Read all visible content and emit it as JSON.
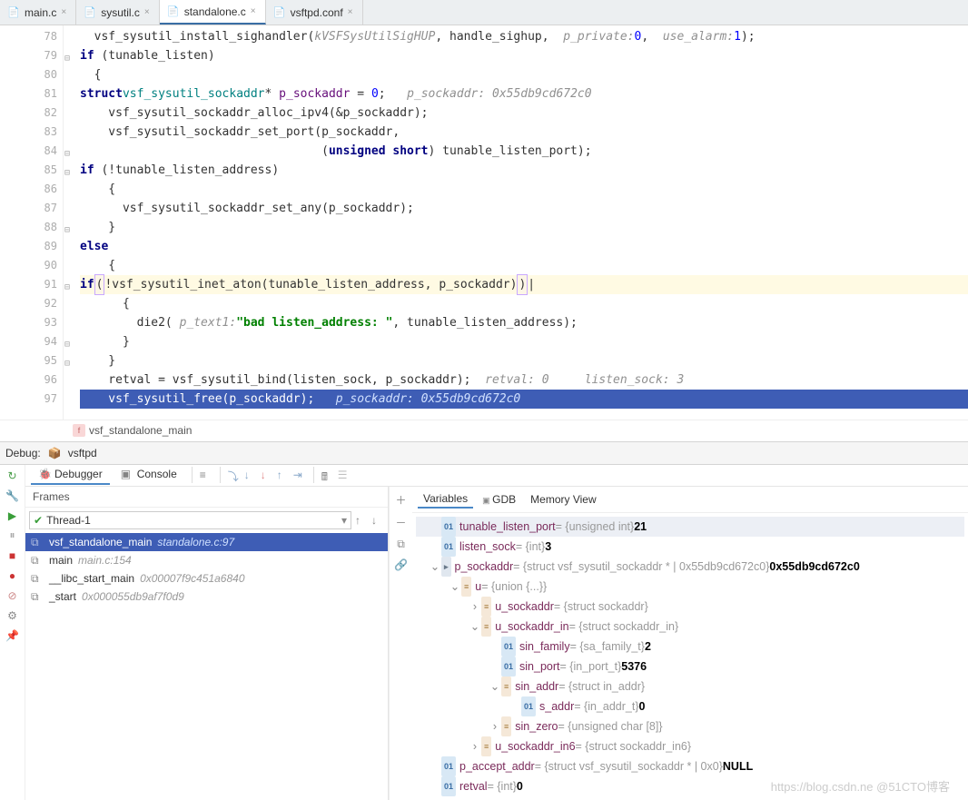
{
  "tabs": [
    {
      "name": "main.c",
      "active": false
    },
    {
      "name": "sysutil.c",
      "active": false
    },
    {
      "name": "standalone.c",
      "active": true
    },
    {
      "name": "vsftpd.conf",
      "active": false
    }
  ],
  "breadcrumb": {
    "fn": "vsf_standalone_main"
  },
  "debug": {
    "label": "Debug:",
    "config": "vsftpd",
    "tabs": {
      "debugger": "Debugger",
      "console": "Console"
    },
    "frames_title": "Frames",
    "thread": "Thread-1",
    "frames": [
      {
        "fn": "vsf_standalone_main",
        "loc": "standalone.c:97",
        "sel": true
      },
      {
        "fn": "main",
        "loc": "main.c:154",
        "sel": false
      },
      {
        "fn": "__libc_start_main",
        "loc": "0x00007f9c451a6840",
        "sel": false
      },
      {
        "fn": "_start",
        "loc": "0x000055db9af7f0d9",
        "sel": false
      }
    ],
    "vars_tabs": {
      "variables": "Variables",
      "gdb": "GDB",
      "memory": "Memory View"
    }
  },
  "variables": [
    {
      "d": 0,
      "ic": "01",
      "name": "tunable_listen_port",
      "type": "{unsigned int}",
      "val": "21",
      "sel": true
    },
    {
      "d": 0,
      "ic": "01",
      "name": "listen_sock",
      "type": "{int}",
      "val": "3"
    },
    {
      "d": 0,
      "ic": "p",
      "name": "p_sockaddr",
      "type": "{struct vsf_sysutil_sockaddr * | 0x55db9cd672c0}",
      "val": "0x55db9cd672c0",
      "exp": "v"
    },
    {
      "d": 1,
      "ic": "f",
      "name": "u",
      "type": "{union {...}}",
      "val": "",
      "exp": "v"
    },
    {
      "d": 2,
      "ic": "f",
      "name": "u_sockaddr",
      "type": "{struct sockaddr}",
      "val": "",
      "exp": ">"
    },
    {
      "d": 2,
      "ic": "f",
      "name": "u_sockaddr_in",
      "type": "{struct sockaddr_in}",
      "val": "",
      "exp": "v"
    },
    {
      "d": 3,
      "ic": "01",
      "name": "sin_family",
      "type": "{sa_family_t}",
      "val": "2"
    },
    {
      "d": 3,
      "ic": "01",
      "name": "sin_port",
      "type": "{in_port_t}",
      "val": "5376"
    },
    {
      "d": 3,
      "ic": "f",
      "name": "sin_addr",
      "type": "{struct in_addr}",
      "val": "",
      "exp": "v"
    },
    {
      "d": 4,
      "ic": "01",
      "name": "s_addr",
      "type": "{in_addr_t}",
      "val": "0"
    },
    {
      "d": 3,
      "ic": "f",
      "name": "sin_zero",
      "type": "{unsigned char [8]}",
      "val": "",
      "exp": ">"
    },
    {
      "d": 2,
      "ic": "f",
      "name": "u_sockaddr_in6",
      "type": "{struct sockaddr_in6}",
      "val": "",
      "exp": ">"
    },
    {
      "d": 0,
      "ic": "01",
      "name": "p_accept_addr",
      "type": "{struct vsf_sysutil_sockaddr * | 0x0}",
      "val": "NULL"
    },
    {
      "d": 0,
      "ic": "01",
      "name": "retval",
      "type": "{int}",
      "val": "0"
    }
  ],
  "code": {
    "start": 78,
    "lines": [
      {
        "n": 78,
        "html": "  vsf_sysutil_install_sighandler(<span class='hint'>kVSFSysUtilSigHUP</span>, handle_sighup,  <span class='hint'>p_private:</span> <span class='num'>0</span>,  <span class='hint'>use_alarm:</span> <span class='num'>1</span>);"
      },
      {
        "n": 79,
        "html": "  <span class='kw'>if</span> (tunable_listen)",
        "fold": "-"
      },
      {
        "n": 80,
        "html": "  {"
      },
      {
        "n": 81,
        "html": "    <span class='kw'>struct</span> <span style='color:#008080'>vsf_sysutil_sockaddr</span>* <span style='color:#660e7a'>p_sockaddr</span> = <span class='num'>0</span>;   <span class='hint'>p_sockaddr: 0x55db9cd672c0</span>"
      },
      {
        "n": 82,
        "html": "    vsf_sysutil_sockaddr_alloc_ipv4(&p_sockaddr);"
      },
      {
        "n": 83,
        "html": "    vsf_sysutil_sockaddr_set_port(p_sockaddr,"
      },
      {
        "n": 84,
        "html": "                                  (<span class='kw'>unsigned short</span>) tunable_listen_port);",
        "fold": "-"
      },
      {
        "n": 85,
        "html": "    <span class='kw'>if</span> (!tunable_listen_address)",
        "fold": "-"
      },
      {
        "n": 86,
        "html": "    {"
      },
      {
        "n": 87,
        "html": "      vsf_sysutil_sockaddr_set_any(p_sockaddr);"
      },
      {
        "n": 88,
        "html": "    }",
        "fold": "-"
      },
      {
        "n": 89,
        "html": "    <span class='kw'>else</span>"
      },
      {
        "n": 90,
        "html": "    {"
      },
      {
        "n": 91,
        "html": "      <span class='kw'>if</span> <span class='caret-box'>(</span>!vsf_sysutil_inet_aton(tunable_listen_address, p_sockaddr)<span class='caret-box'>)</span>|",
        "hl": true,
        "fold": "-"
      },
      {
        "n": 92,
        "html": "      {"
      },
      {
        "n": 93,
        "html": "        die2( <span class='hint'>p_text1:</span> <span class='str'>\"bad listen_address: \"</span>, tunable_listen_address);"
      },
      {
        "n": 94,
        "html": "      }",
        "fold": "-"
      },
      {
        "n": 95,
        "html": "    }",
        "fold": "-"
      },
      {
        "n": 96,
        "html": "    retval = vsf_sysutil_bind(listen_sock, p_sockaddr);  <span class='hint'>retval: 0     listen_sock: 3</span>"
      },
      {
        "n": 97,
        "html": "    vsf_sysutil_free(p_sockaddr);   <span class='hint'>p_sockaddr: 0x55db9cd672c0</span>",
        "exec": true,
        "gut": "➔🐞"
      }
    ]
  },
  "watermark": "https://blog.csdn.ne @51CTO博客"
}
